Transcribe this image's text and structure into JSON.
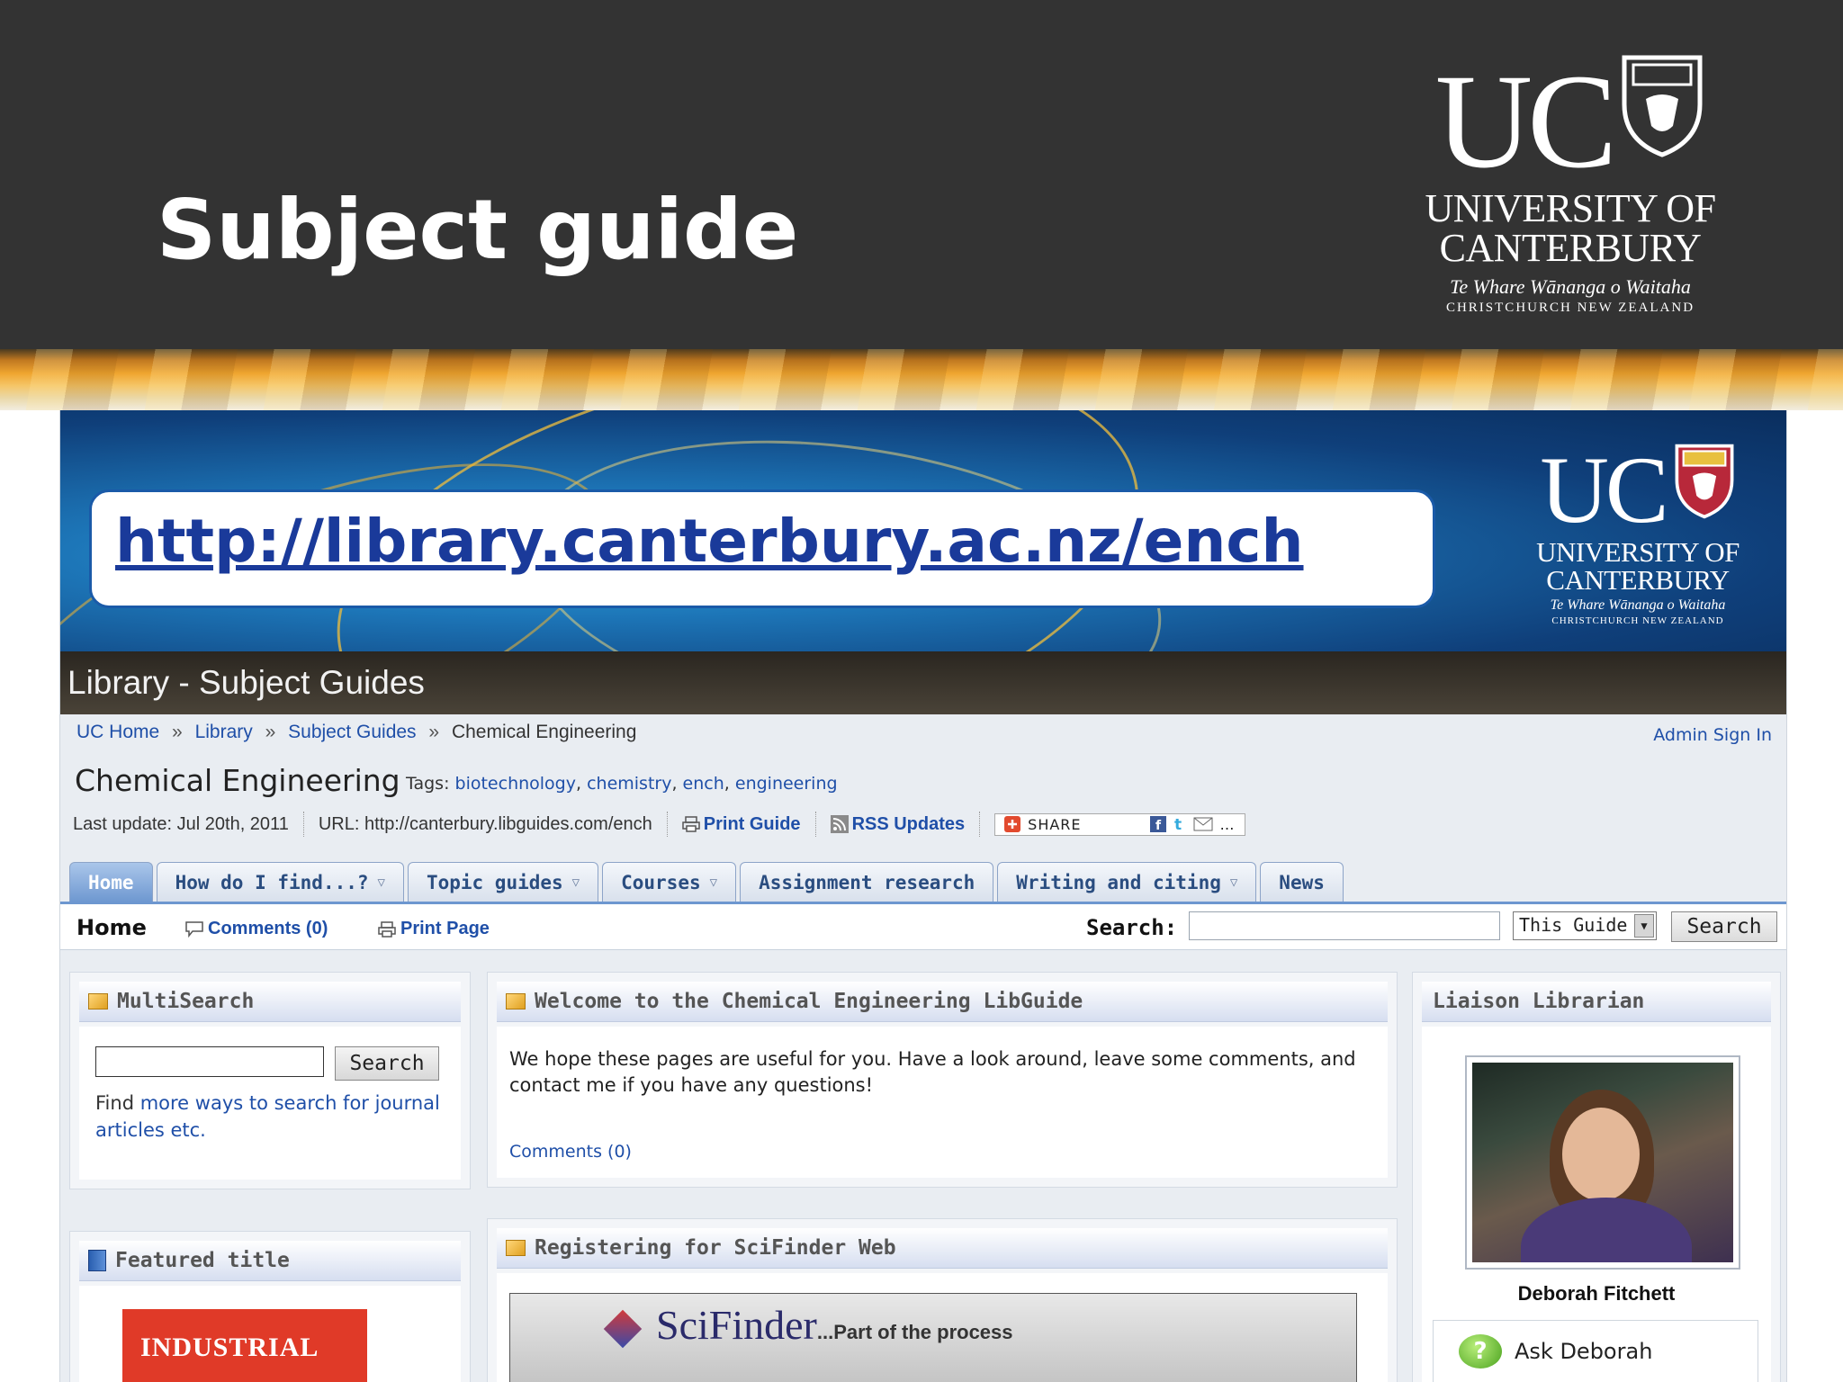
{
  "slide": {
    "title": "Subject guide",
    "logo": {
      "letters": "UC",
      "line1": "UNIVERSITY OF",
      "line2": "CANTERBURY",
      "maori": "Te Whare Wānanga o Waitaha",
      "city": "CHRISTCHURCH NEW ZEALAND"
    }
  },
  "screenshot": {
    "url": "http://library.canterbury.ac.nz/ench",
    "banner_logo": {
      "letters": "UC",
      "line1": "UNIVERSITY OF",
      "line2": "CANTERBURY",
      "maori": "Te Whare Wānanga o Waitaha",
      "city": "CHRISTCHURCH NEW ZEALAND"
    },
    "header_title": "Library - Subject Guides",
    "breadcrumbs": [
      "UC Home",
      "Library",
      "Subject Guides",
      "Chemical Engineering"
    ],
    "breadcrumb_sep": "»",
    "admin_link": "Admin Sign In",
    "page_title": "Chemical Engineering",
    "tags_label": "Tags:",
    "tags": [
      "biotechnology",
      "chemistry",
      "ench",
      "engineering"
    ],
    "meta": {
      "last_update": "Last update: Jul 20th, 2011",
      "url": "URL: http://canterbury.libguides.com/ench",
      "print_guide": "Print Guide",
      "rss": "RSS Updates",
      "share": "SHARE"
    },
    "tabs": [
      {
        "label": "Home",
        "dropdown": false,
        "active": true
      },
      {
        "label": "How do I find...?",
        "dropdown": true,
        "active": false
      },
      {
        "label": "Topic guides",
        "dropdown": true,
        "active": false
      },
      {
        "label": "Courses",
        "dropdown": true,
        "active": false
      },
      {
        "label": "Assignment research",
        "dropdown": false,
        "active": false
      },
      {
        "label": "Writing and citing",
        "dropdown": true,
        "active": false
      },
      {
        "label": "News",
        "dropdown": false,
        "active": false
      }
    ],
    "subnav": {
      "home": "Home",
      "comments": "Comments (0)",
      "print_page": "Print Page",
      "search_label": "Search:",
      "search_value": "",
      "scope": "This Guide",
      "search_button": "Search"
    },
    "multisearch": {
      "title": "MultiSearch",
      "button": "Search",
      "text_prefix": "Find ",
      "link": "more ways to search for journal articles etc."
    },
    "welcome": {
      "title": "Welcome to the Chemical Engineering LibGuide",
      "text": "We hope these pages are useful for you.  Have a look around, leave some comments, and contact me if you have any questions!",
      "comments": "Comments (0)"
    },
    "scifinder": {
      "title": "Registering for SciFinder Web",
      "video_logo": "SciFinder",
      "video_tag": "...Part of the process"
    },
    "featured": {
      "title": "Featured title",
      "book_text": "INDUSTRIAL"
    },
    "librarian": {
      "title": "Liaison Librarian",
      "name": "Deborah Fitchett",
      "ask": "Ask Deborah"
    }
  }
}
